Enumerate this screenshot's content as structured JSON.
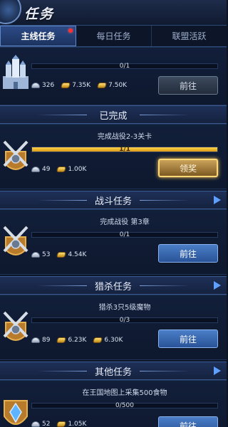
{
  "header": {
    "title": "任务"
  },
  "tabs": [
    {
      "label": "主线任务",
      "active": true,
      "has_notification": true
    },
    {
      "label": "每日任务",
      "active": false
    },
    {
      "label": "联盟活跃",
      "active": false
    }
  ],
  "main_task": {
    "progress": "0/1",
    "progress_fraction": 0,
    "rewards": [
      "326",
      "7.35K",
      "7.50K"
    ],
    "button_label": "前往"
  },
  "completed_section": {
    "header": "已完成",
    "task": {
      "description": "完成战役2-3关卡",
      "progress": "1/1",
      "progress_fraction": 1,
      "rewards": [
        "49",
        "1.00K"
      ],
      "button_label": "领奖"
    }
  },
  "battle_section": {
    "header": "战斗任务",
    "task": {
      "description": "完成战役 第3章",
      "progress": "0/1",
      "progress_fraction": 0,
      "rewards": [
        "53",
        "4.54K"
      ],
      "button_label": "前往"
    }
  },
  "hunt_section": {
    "header": "猎杀任务",
    "task": {
      "description": "猎杀3只5级魔物",
      "progress": "0/3",
      "progress_fraction": 0,
      "rewards": [
        "89",
        "6.23K",
        "6.30K"
      ],
      "button_label": "前往"
    }
  },
  "other_section": {
    "header": "其他任务",
    "task": {
      "description": "在王国地图上采集500食物",
      "progress": "0/500",
      "progress_fraction": 0,
      "rewards": [
        "52",
        "1.05K"
      ],
      "button_label": "前往"
    }
  },
  "colors": {
    "accent_blue": "#4a7ec7",
    "gold": "#ffd24a",
    "notification": "#ff3030"
  }
}
